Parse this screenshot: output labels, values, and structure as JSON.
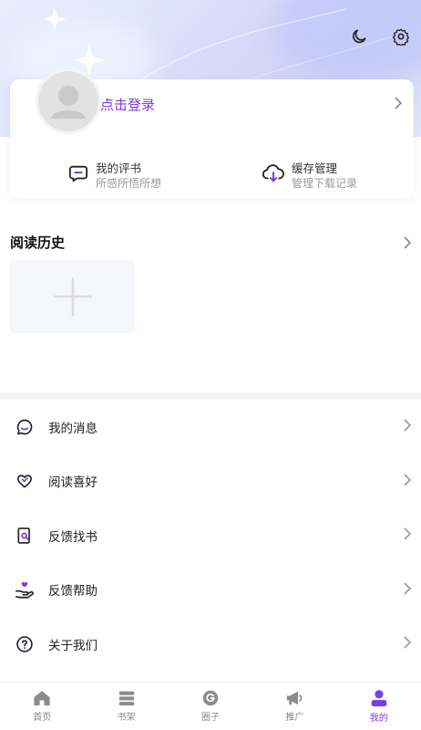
{
  "profile": {
    "login_label": "点击登录",
    "quick_actions": [
      {
        "title": "我的评书",
        "subtitle": "所感所悟所想",
        "icon": "comment-bubble-icon"
      },
      {
        "title": "缓存管理",
        "subtitle": "管理下载记录",
        "icon": "cloud-download-icon"
      }
    ]
  },
  "history": {
    "title": "阅读历史"
  },
  "menu": {
    "items": [
      {
        "label": "我的消息",
        "icon": "message-icon"
      },
      {
        "label": "阅读喜好",
        "icon": "heart-icon"
      },
      {
        "label": "反馈找书",
        "icon": "search-book-icon"
      },
      {
        "label": "反馈帮助",
        "icon": "help-hand-icon"
      },
      {
        "label": "关于我们",
        "icon": "question-circle-icon"
      }
    ]
  },
  "tabbar": {
    "items": [
      {
        "label": "首页",
        "icon": "home-icon"
      },
      {
        "label": "书架",
        "icon": "bookshelf-icon"
      },
      {
        "label": "圈子",
        "icon": "circle-icon"
      },
      {
        "label": "推广",
        "icon": "megaphone-icon"
      },
      {
        "label": "我的",
        "icon": "user-icon"
      }
    ],
    "active_index": 4
  },
  "colors": {
    "accent": "#7a3fe0",
    "inactive": "#888888"
  }
}
